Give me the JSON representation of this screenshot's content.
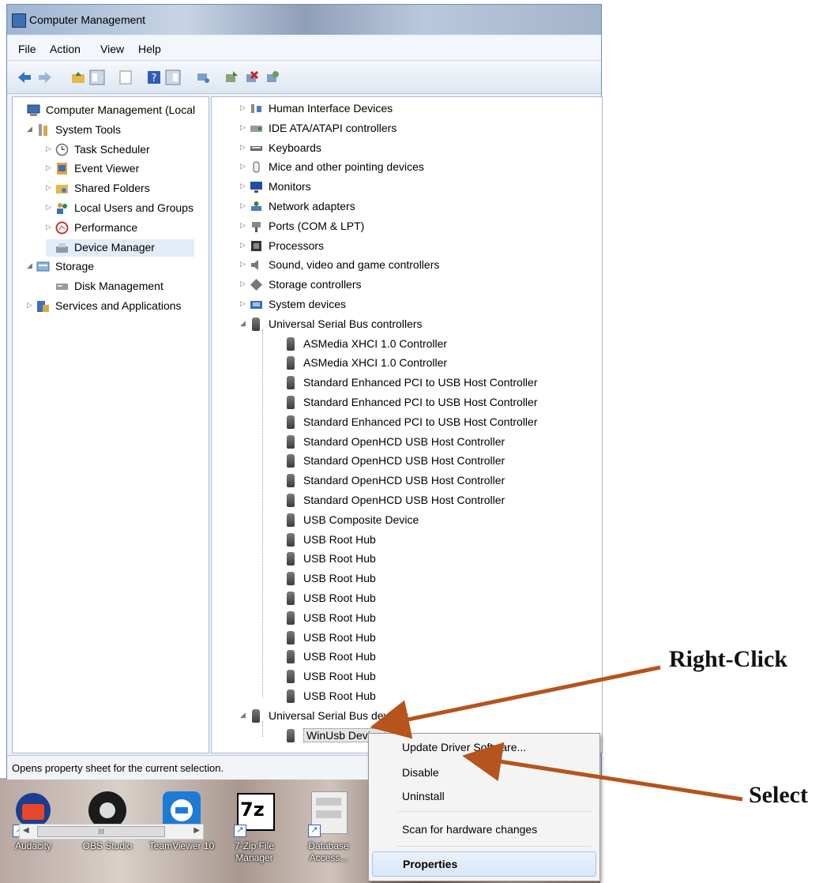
{
  "window": {
    "title": "Computer Management"
  },
  "menu": [
    "File",
    "Action",
    "View",
    "Help"
  ],
  "left_tree": [
    {
      "label": "Computer Management (Local",
      "level": 0,
      "icon": "computer-management-icon"
    },
    {
      "label": "System Tools",
      "level": 1,
      "icon": "tools-icon"
    },
    {
      "label": "Task Scheduler",
      "level": 2,
      "icon": "clock-icon"
    },
    {
      "label": "Event Viewer",
      "level": 2,
      "icon": "event-viewer-icon"
    },
    {
      "label": "Shared Folders",
      "level": 2,
      "icon": "shared-folder-icon"
    },
    {
      "label": "Local Users and Groups",
      "level": 2,
      "icon": "users-icon"
    },
    {
      "label": "Performance",
      "level": 2,
      "icon": "performance-icon"
    },
    {
      "label": "Device Manager",
      "level": 2,
      "icon": "device-manager-icon"
    },
    {
      "label": "Storage",
      "level": 1,
      "icon": "storage-icon"
    },
    {
      "label": "Disk Management",
      "level": 2,
      "icon": "disk-icon"
    },
    {
      "label": "Services and Applications",
      "level": 1,
      "icon": "services-icon"
    }
  ],
  "scrollbar": {
    "thumb": "III"
  },
  "device_tree": [
    {
      "label": "Human Interface Devices",
      "level": 0
    },
    {
      "label": "IDE ATA/ATAPI controllers",
      "level": 0
    },
    {
      "label": "Keyboards",
      "level": 0
    },
    {
      "label": "Mice and other pointing devices",
      "level": 0
    },
    {
      "label": "Monitors",
      "level": 0
    },
    {
      "label": "Network adapters",
      "level": 0
    },
    {
      "label": "Ports (COM & LPT)",
      "level": 0
    },
    {
      "label": "Processors",
      "level": 0
    },
    {
      "label": "Sound, video and game controllers",
      "level": 0
    },
    {
      "label": "Storage controllers",
      "level": 0
    },
    {
      "label": "System devices",
      "level": 0
    },
    {
      "label": "Universal Serial Bus controllers",
      "level": 0
    },
    {
      "label": "ASMedia XHCI 1.0 Controller",
      "level": 1
    },
    {
      "label": "ASMedia XHCI 1.0 Controller",
      "level": 1
    },
    {
      "label": "Standard Enhanced PCI to USB Host Controller",
      "level": 1
    },
    {
      "label": "Standard Enhanced PCI to USB Host Controller",
      "level": 1
    },
    {
      "label": "Standard Enhanced PCI to USB Host Controller",
      "level": 1
    },
    {
      "label": "Standard OpenHCD USB Host Controller",
      "level": 1
    },
    {
      "label": "Standard OpenHCD USB Host Controller",
      "level": 1
    },
    {
      "label": "Standard OpenHCD USB Host Controller",
      "level": 1
    },
    {
      "label": "Standard OpenHCD USB Host Controller",
      "level": 1
    },
    {
      "label": "USB Composite Device",
      "level": 1
    },
    {
      "label": "USB Root Hub",
      "level": 1
    },
    {
      "label": "USB Root Hub",
      "level": 1
    },
    {
      "label": "USB Root Hub",
      "level": 1
    },
    {
      "label": "USB Root Hub",
      "level": 1
    },
    {
      "label": "USB Root Hub",
      "level": 1
    },
    {
      "label": "USB Root Hub",
      "level": 1
    },
    {
      "label": "USB Root Hub",
      "level": 1
    },
    {
      "label": "USB Root Hub",
      "level": 1
    },
    {
      "label": "USB Root Hub",
      "level": 1
    },
    {
      "label": "Universal Serial Bus devices",
      "level": 0
    },
    {
      "label": "WinUsb Device",
      "level": 1
    }
  ],
  "status": "Opens property sheet for the current selection.",
  "context_menu": [
    "Update Driver Software...",
    "Disable",
    "Uninstall",
    "Scan for hardware changes",
    "Properties"
  ],
  "desktop_icons": [
    {
      "label": "Audacity",
      "icon": "audacity-icon"
    },
    {
      "label": "OBS Studio",
      "icon": "obs-icon"
    },
    {
      "label": "TeamViewer 10",
      "icon": "teamviewer-icon"
    },
    {
      "label": "7-Zip File Manager",
      "icon": "7zip-icon"
    },
    {
      "label": "Database Access...",
      "icon": "database-icon"
    }
  ],
  "annotations": {
    "right_click": "Right-Click",
    "select": "Select",
    "arrow_color": "#b5541c"
  }
}
